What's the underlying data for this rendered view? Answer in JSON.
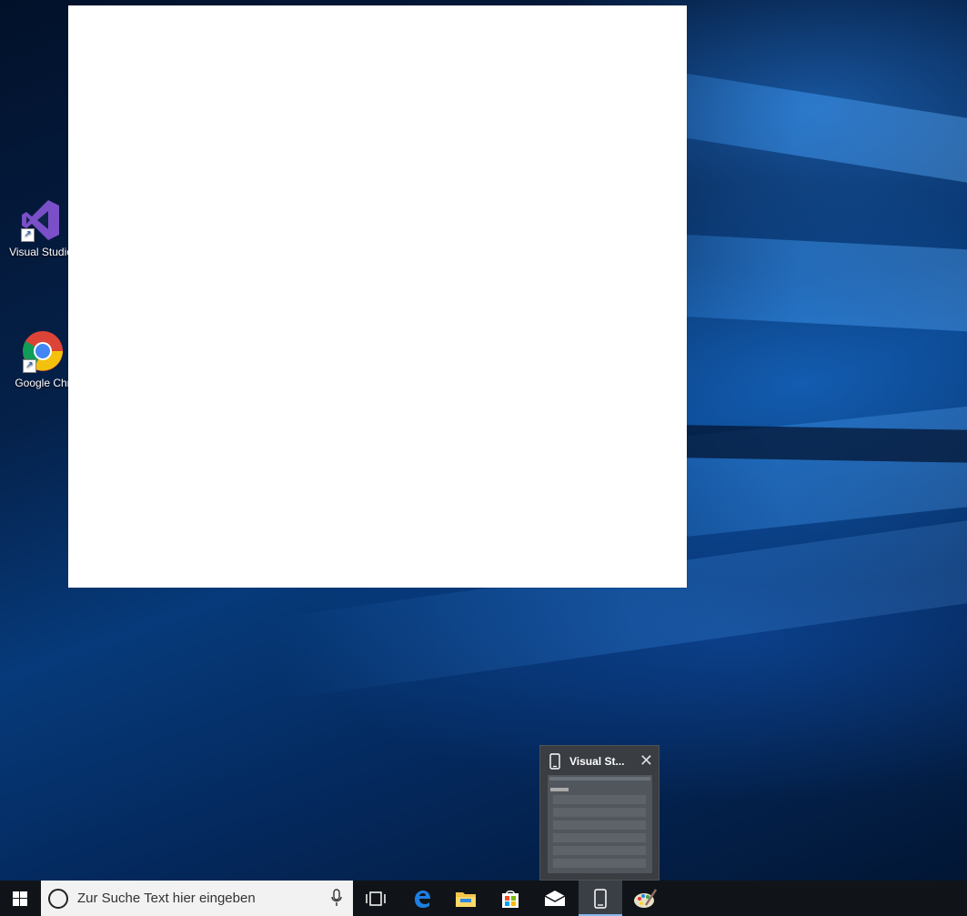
{
  "desktop": {
    "icons": [
      {
        "label": "Visual Studio",
        "icon": "visual-studio-icon"
      },
      {
        "label": "Google Chr",
        "icon": "chrome-icon"
      }
    ]
  },
  "thumbnail": {
    "title": "Visual St...",
    "icon": "phone-icon",
    "close": "close-icon"
  },
  "taskbar": {
    "search_placeholder": "Zur Suche Text hier eingeben",
    "buttons": [
      "start-icon",
      "task-view-icon",
      "edge-icon",
      "file-explorer-icon",
      "store-icon",
      "mail-icon",
      "phone-app-icon",
      "paint-icon"
    ]
  }
}
